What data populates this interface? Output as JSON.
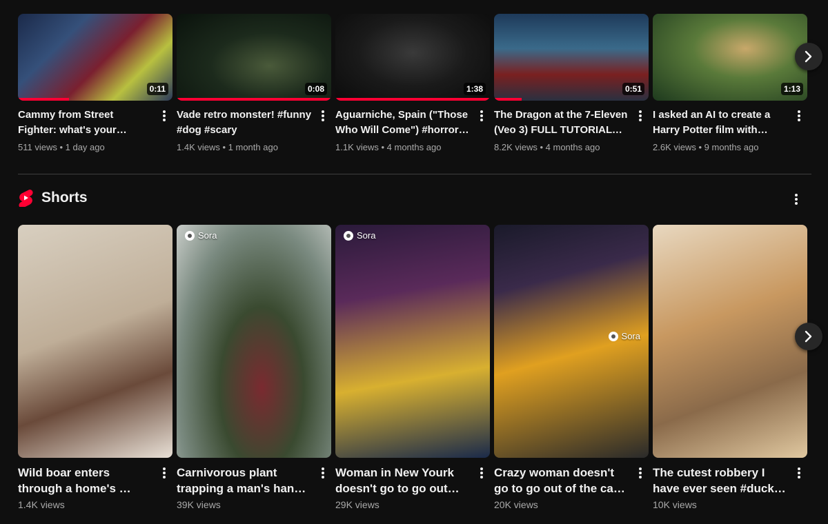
{
  "videos": [
    {
      "title": "Cammy from Street Fighter: what's your favourite video…",
      "views": "511 views",
      "age": "1 day ago",
      "duration": "0:11",
      "progress": 0.33
    },
    {
      "title": "Vade retro monster! #funny #dog #scary",
      "views": "1.4K views",
      "age": "1 month ago",
      "duration": "0:08",
      "progress": 1.0
    },
    {
      "title": "Aguarniche, Spain (\"Those Who Will Come\") #horror…",
      "views": "1.1K views",
      "age": "4 months ago",
      "duration": "1:38",
      "progress": 1.0
    },
    {
      "title": "The Dragon at the 7-Eleven (Veo 3) FULL TUTORIAL in…",
      "views": "8.2K views",
      "age": "4 months ago",
      "duration": "0:51",
      "progress": 0.18
    },
    {
      "title": "I asked an AI to create a Harry Potter film with this…",
      "views": "2.6K views",
      "age": "9 months ago",
      "duration": "1:13",
      "progress": 0
    }
  ],
  "shelf": {
    "title": "Shorts"
  },
  "shorts": [
    {
      "title": "Wild boar enters through a home's …",
      "views": "1.4K views",
      "badge": ""
    },
    {
      "title": "Carnivorous plant trapping a man's hand …",
      "views": "39K views",
      "badge": "Sora"
    },
    {
      "title": "Woman in New Yourk doesn't go to go out of…",
      "views": "29K views",
      "badge": "Sora"
    },
    {
      "title": "Crazy woman doesn't go to go out of the car! …",
      "views": "20K views",
      "badge": "Sora"
    },
    {
      "title": "The cutest robbery I have ever seen #duck …",
      "views": "10K views",
      "badge": ""
    }
  ],
  "colors": {
    "background": "#0f0f0f",
    "accent": "#ff0033",
    "secondary_text": "#aaaaaa"
  },
  "icons": {
    "more": "more-vert-icon",
    "next": "chevron-right-icon",
    "shorts": "shorts-logo-icon"
  }
}
